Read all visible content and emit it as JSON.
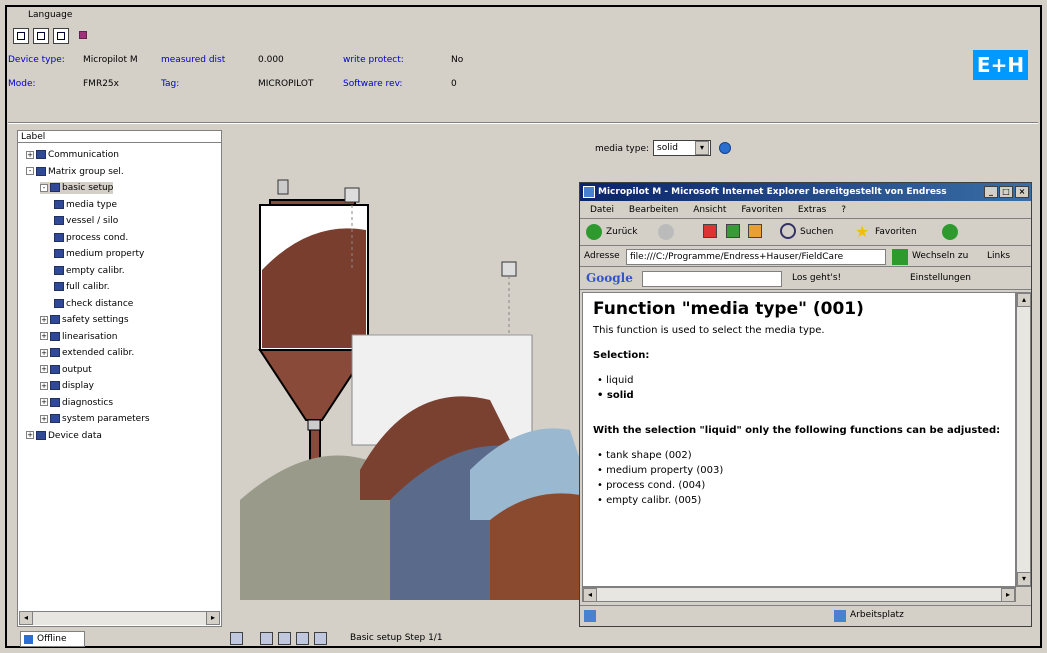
{
  "menubar": {
    "title": "Language"
  },
  "device": {
    "type_label": "Device type:",
    "type_value": "Micropilot M",
    "measured_label": "measured dist",
    "measured_value": "0.000",
    "write_protect_label": "write protect:",
    "write_protect_value": "No",
    "mode_label": "Mode:",
    "mode_value": "FMR25x",
    "tag_label": "Tag:",
    "tag_value": "MICROPILOT",
    "software_label": "Software rev:",
    "software_value": "0",
    "logo_text": "E+H"
  },
  "tree": {
    "header": "Label",
    "items": [
      {
        "label": "Communication",
        "level": 0,
        "expander": "+"
      },
      {
        "label": "Matrix group sel.",
        "level": 0,
        "expander": "-"
      },
      {
        "label": "basic setup",
        "level": 1,
        "expander": "-",
        "selected": true
      },
      {
        "label": "media type",
        "level": 2
      },
      {
        "label": "vessel / silo",
        "level": 2
      },
      {
        "label": "process cond.",
        "level": 2
      },
      {
        "label": "medium property",
        "level": 2
      },
      {
        "label": "empty calibr.",
        "level": 2
      },
      {
        "label": "full calibr.",
        "level": 2
      },
      {
        "label": "check distance",
        "level": 2
      },
      {
        "label": "safety settings",
        "level": 1,
        "expander": "+"
      },
      {
        "label": "linearisation",
        "level": 1,
        "expander": "+"
      },
      {
        "label": "extended calibr.",
        "level": 1,
        "expander": "+"
      },
      {
        "label": "output",
        "level": 1,
        "expander": "+"
      },
      {
        "label": "display",
        "level": 1,
        "expander": "+"
      },
      {
        "label": "diagnostics",
        "level": 1,
        "expander": "+"
      },
      {
        "label": "system parameters",
        "level": 1,
        "expander": "+"
      },
      {
        "label": "Device data",
        "level": 0,
        "expander": "+"
      }
    ]
  },
  "media": {
    "label": "media type:",
    "value": "solid"
  },
  "ie": {
    "title": "Micropilot M - Microsoft Internet Explorer bereitgestellt von Endress",
    "menu": [
      "Datei",
      "Bearbeiten",
      "Ansicht",
      "Favoriten",
      "Extras",
      "?"
    ],
    "toolbar": {
      "back": "Zurück",
      "search": "Suchen",
      "favorites": "Favoriten"
    },
    "address_label": "Adresse",
    "address_value": "file:///C:/Programme/Endress+Hauser/FieldCare",
    "go_label": "Wechseln zu",
    "links_label": "Links",
    "google_label": "Google",
    "google_go": "Los geht's!",
    "google_settings": "Einstellungen",
    "status_zone": "Arbeitsplatz"
  },
  "content": {
    "title": "Function \"media type\" (001)",
    "intro": "This function is used to select the media type.",
    "selection_heading": "Selection:",
    "options": [
      "liquid",
      "solid"
    ],
    "liquid_note": "With the selection \"liquid\" only the following functions can be adjusted:",
    "functions": [
      "tank shape (002)",
      "medium property (003)",
      "process cond. (004)",
      "empty calibr. (005)"
    ]
  },
  "bottom": {
    "tab_label": "Offline",
    "status": "Basic setup Step 1/1"
  }
}
